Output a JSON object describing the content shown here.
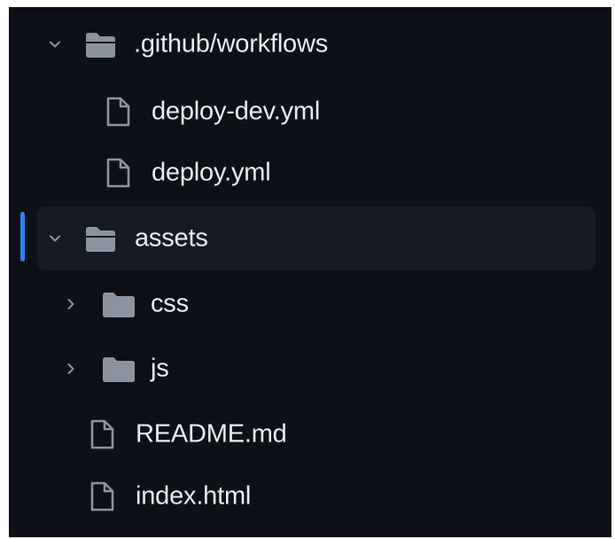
{
  "tree": {
    "items": [
      {
        "name": ".github/workflows",
        "kind": "folder",
        "state": "expanded",
        "icon": "folder-open-icon"
      },
      {
        "name": "deploy-dev.yml",
        "kind": "file",
        "icon": "file-icon"
      },
      {
        "name": "deploy.yml",
        "kind": "file",
        "icon": "file-icon"
      },
      {
        "name": "assets",
        "kind": "folder",
        "state": "expanded",
        "selected": true,
        "icon": "folder-open-icon"
      },
      {
        "name": "css",
        "kind": "folder",
        "state": "collapsed",
        "icon": "folder-icon"
      },
      {
        "name": "js",
        "kind": "folder",
        "state": "collapsed",
        "icon": "folder-icon"
      },
      {
        "name": "README.md",
        "kind": "file",
        "icon": "file-icon"
      },
      {
        "name": "index.html",
        "kind": "file",
        "icon": "file-icon"
      }
    ]
  },
  "colors": {
    "background": "#0d1117",
    "selected_row": "#161b22",
    "accent": "#2f81f7",
    "text": "#e6edf3",
    "icon": "#8b949e"
  }
}
